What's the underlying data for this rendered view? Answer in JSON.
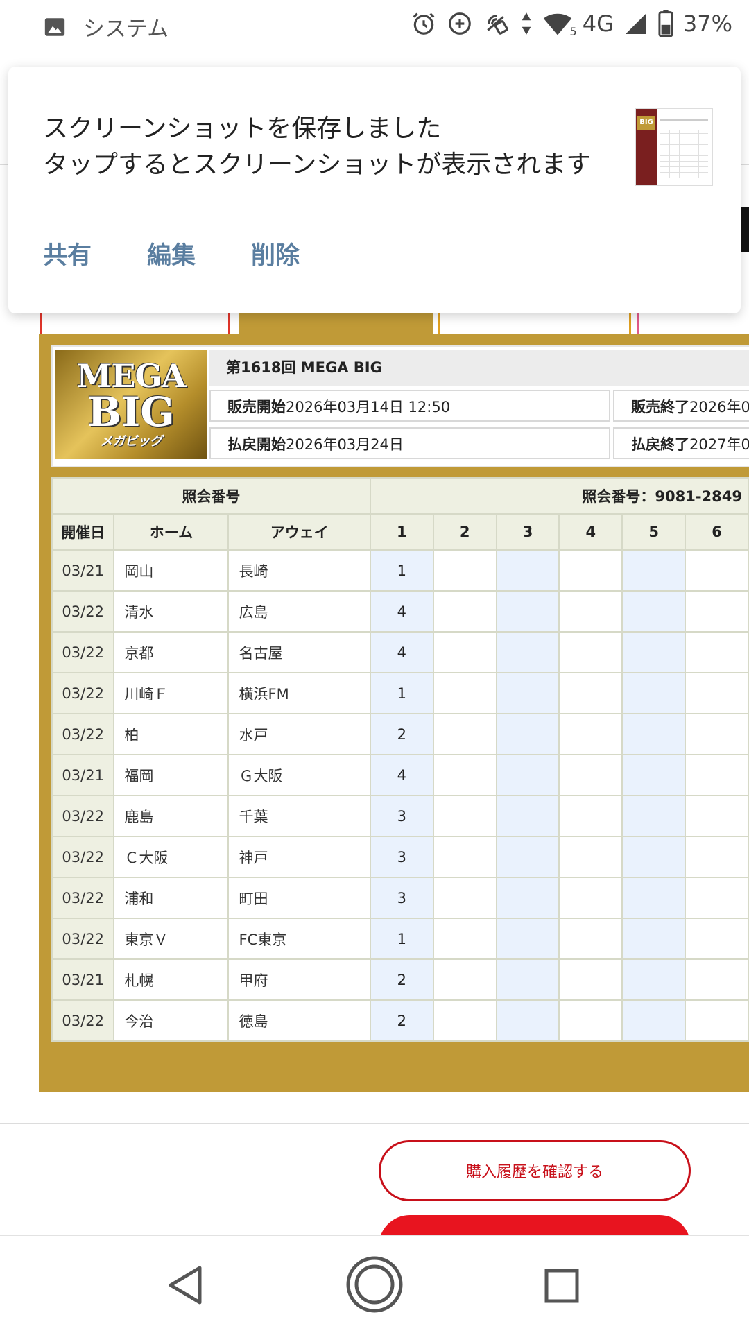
{
  "status_bar": {
    "app_label": "システム",
    "network": "4G",
    "wifi_level": "5",
    "battery": "37%",
    "icons": [
      "image-icon",
      "alarm-icon",
      "data-saver-icon",
      "nfc-icon",
      "data-arrows-icon",
      "wifi-icon",
      "signal-icon",
      "battery-icon"
    ]
  },
  "notification": {
    "line1": "スクリーンショットを保存しました",
    "line2": "タップするとスクリーンショットが表示されます",
    "actions": [
      "共有",
      "編集",
      "削除"
    ],
    "thumb_logo": "BIG",
    "accent_color": "#5a7ea0"
  },
  "ticket": {
    "round_title": "第1618回 MEGA BIG",
    "logo": {
      "line1": "MEGA",
      "line2": "BIG",
      "line3": "メガビッグ"
    },
    "sale_start": {
      "label": "販売開始",
      "value": "2026年03月14日 12:50"
    },
    "sale_end": {
      "label": "販売終了",
      "value": "2026年0"
    },
    "payout_start": {
      "label": "払戻開始",
      "value": "2026年03月24日"
    },
    "payout_end": {
      "label": "払戻終了",
      "value": "2027年0"
    },
    "inquiry_header": "照会番号",
    "inquiry_number": "照会番号：9081-2849",
    "columns": [
      "開催日",
      "ホーム",
      "アウェイ",
      "1",
      "2",
      "3",
      "4",
      "5",
      "6"
    ],
    "rows": [
      {
        "date": "03/21",
        "home": "岡山",
        "away": "長崎",
        "c1": "1"
      },
      {
        "date": "03/22",
        "home": "清水",
        "away": "広島",
        "c1": "4"
      },
      {
        "date": "03/22",
        "home": "京都",
        "away": "名古屋",
        "c1": "4"
      },
      {
        "date": "03/22",
        "home": "川崎Ｆ",
        "away": "横浜FM",
        "c1": "1"
      },
      {
        "date": "03/22",
        "home": "柏",
        "away": "水戸",
        "c1": "2"
      },
      {
        "date": "03/21",
        "home": "福岡",
        "away": "Ｇ大阪",
        "c1": "4"
      },
      {
        "date": "03/22",
        "home": "鹿島",
        "away": "千葉",
        "c1": "3"
      },
      {
        "date": "03/22",
        "home": "Ｃ大阪",
        "away": "神戸",
        "c1": "3"
      },
      {
        "date": "03/22",
        "home": "浦和",
        "away": "町田",
        "c1": "3"
      },
      {
        "date": "03/22",
        "home": "東京Ｖ",
        "away": "FC東京",
        "c1": "1"
      },
      {
        "date": "03/21",
        "home": "札幌",
        "away": "甲府",
        "c1": "2"
      },
      {
        "date": "03/22",
        "home": "今治",
        "away": "徳島",
        "c1": "2"
      }
    ]
  },
  "buttons": {
    "history": "購入履歴を確認する",
    "primary_color": "#e8141f"
  },
  "nav": [
    "back-icon",
    "home-icon",
    "recents-icon"
  ]
}
